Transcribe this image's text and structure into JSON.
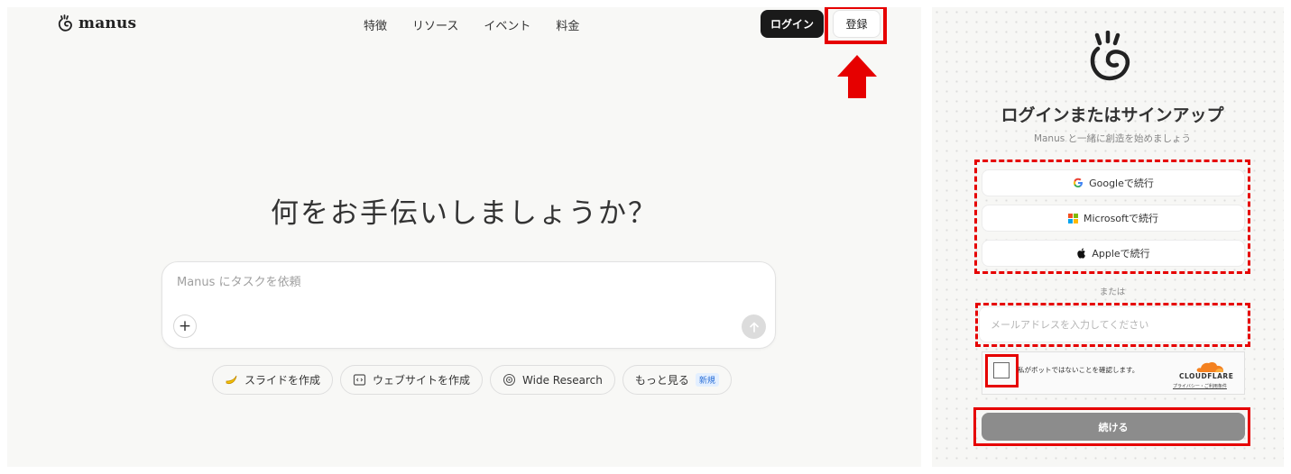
{
  "landing": {
    "brand": "manus",
    "brand_icon": "manus-hand-icon",
    "nav": [
      "特徴",
      "リソース",
      "イベント",
      "料金"
    ],
    "login_label": "ログイン",
    "register_label": "登録",
    "hero_text": "何をお手伝いしましょうか？",
    "prompt_placeholder": "Manus にタスクを依頼",
    "plus_label": "+",
    "chips": [
      {
        "label": "スライドを作成",
        "icon": "banana-icon"
      },
      {
        "label": "ウェブサイトを作成",
        "icon": "code-window-icon"
      },
      {
        "label": "Wide Research",
        "icon": "radar-icon"
      },
      {
        "label": "もっと見る",
        "badge": "新規"
      }
    ],
    "annotation_color": "#e60000"
  },
  "login_dialog": {
    "title": "ログインまたはサインアップ",
    "subtitle": "Manus と一緒に創造を始めましょう",
    "google_label": "Googleで続行",
    "microsoft_label": "Microsoftで続行",
    "apple_label": "Appleで続行",
    "or_label": "または",
    "email_placeholder": "メールアドレスを入力してください",
    "captcha_label": "私がボットではないことを確認します。",
    "captcha_brand": "CLOUDFLARE",
    "captcha_links": "プライバシー・ご利用条件",
    "continue_label": "続ける"
  }
}
